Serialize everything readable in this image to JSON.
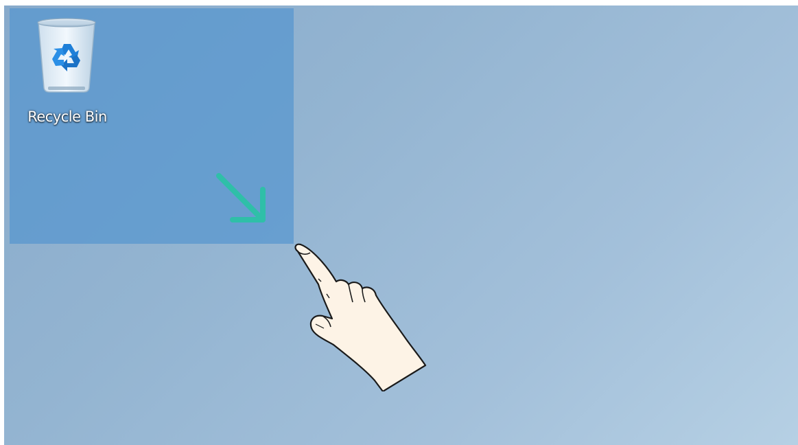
{
  "desktop": {
    "icons": [
      {
        "label": "Recycle Bin",
        "icon": "recycle-bin-icon"
      }
    ],
    "selection": {
      "state": "active drag-select",
      "direction": "down-right"
    },
    "colors": {
      "wallpaper": "#93b4d1",
      "selection": "#5696cf",
      "arrow": "#2fbfa8",
      "hand_fill": "#fdf3e6"
    }
  },
  "annotations": {
    "arrow_icon": "arrow-down-right-icon",
    "pointer_icon": "hand-pointer-icon"
  }
}
